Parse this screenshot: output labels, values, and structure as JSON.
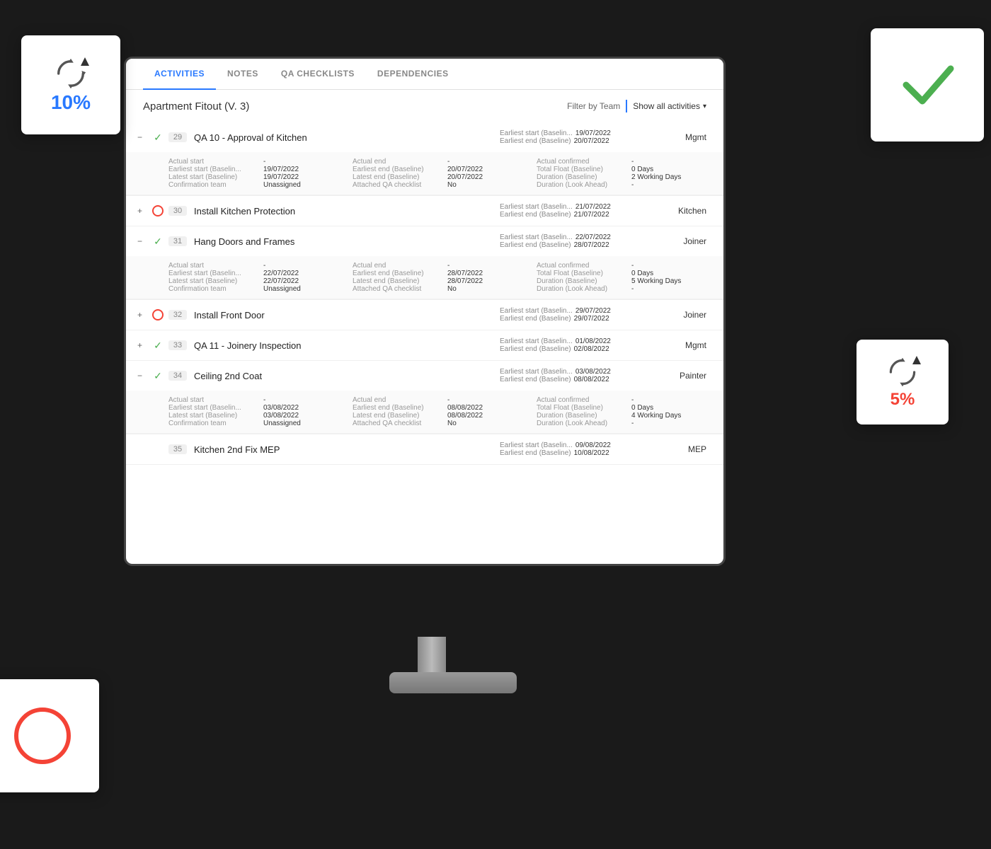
{
  "tabs": [
    {
      "id": "activities",
      "label": "ACTIVITIES",
      "active": true
    },
    {
      "id": "notes",
      "label": "NOTES",
      "active": false
    },
    {
      "id": "qa-checklists",
      "label": "QA CHECKLISTS",
      "active": false
    },
    {
      "id": "dependencies",
      "label": "DEPENDENCIES",
      "active": false
    }
  ],
  "header": {
    "project_title": "Apartment Fitout (V. 3)",
    "filter_label": "Filter by Team",
    "filter_value": "Show all activities"
  },
  "activities": [
    {
      "id": "qa10",
      "num": "29",
      "name": "QA 10 - Approval of Kitchen",
      "expanded": true,
      "status": "check",
      "expand_symbol": "−",
      "earliest_start_label": "Earliest start (Baselin...",
      "earliest_start": "19/07/2022",
      "earliest_end_label": "Earliest end (Baseline)",
      "earliest_end": "20/07/2022",
      "team": "Mgmt",
      "details": {
        "col1": [
          {
            "label": "Actual start",
            "value": "-"
          },
          {
            "label": "Earliest start (Baselin...",
            "value": "19/07/2022"
          },
          {
            "label": "Latest start (Baseline)",
            "value": "19/07/2022"
          },
          {
            "label": "Confirmation team",
            "value": "Unassigned"
          }
        ],
        "col2": [
          {
            "label": "Actual end",
            "value": "-"
          },
          {
            "label": "Earliest end (Baseline)",
            "value": "20/07/2022"
          },
          {
            "label": "Latest end (Baseline)",
            "value": "20/07/2022"
          },
          {
            "label": "Attached QA checklist",
            "value": "No"
          }
        ],
        "col3": [
          {
            "label": "Actual confirmed",
            "value": "-"
          },
          {
            "label": "Total Float (Baseline)",
            "value": "0 Days"
          },
          {
            "label": "Duration (Baseline)",
            "value": "2 Working Days"
          },
          {
            "label": "Duration (Look Ahead)",
            "value": "-"
          }
        ]
      }
    },
    {
      "id": "install30",
      "num": "30",
      "name": "Install Kitchen Protection",
      "expanded": false,
      "status": "circle",
      "expand_symbol": "+",
      "earliest_start_label": "Earliest start (Baselin...",
      "earliest_start": "21/07/2022",
      "earliest_end_label": "Earliest end (Baseline)",
      "earliest_end": "21/07/2022",
      "team": "Kitchen"
    },
    {
      "id": "hang31",
      "num": "31",
      "name": "Hang Doors and Frames",
      "expanded": true,
      "status": "check",
      "expand_symbol": "−",
      "earliest_start_label": "Earliest start (Baselin...",
      "earliest_start": "22/07/2022",
      "earliest_end_label": "Earliest end (Baseline)",
      "earliest_end": "28/07/2022",
      "team": "Joiner",
      "details": {
        "col1": [
          {
            "label": "Actual start",
            "value": "-"
          },
          {
            "label": "Earliest start (Baselin...",
            "value": "22/07/2022"
          },
          {
            "label": "Latest start (Baseline)",
            "value": "22/07/2022"
          },
          {
            "label": "Confirmation team",
            "value": "Unassigned"
          }
        ],
        "col2": [
          {
            "label": "Actual end",
            "value": "-"
          },
          {
            "label": "Earliest end (Baseline)",
            "value": "28/07/2022"
          },
          {
            "label": "Latest end (Baseline)",
            "value": "28/07/2022"
          },
          {
            "label": "Attached QA checklist",
            "value": "No"
          }
        ],
        "col3": [
          {
            "label": "Actual confirmed",
            "value": "-"
          },
          {
            "label": "Total Float (Baseline)",
            "value": "0 Days"
          },
          {
            "label": "Duration (Baseline)",
            "value": "5 Working Days"
          },
          {
            "label": "Duration (Look Ahead)",
            "value": "-"
          }
        ]
      }
    },
    {
      "id": "front32",
      "num": "32",
      "name": "Install Front Door",
      "expanded": false,
      "status": "circle",
      "expand_symbol": "+",
      "earliest_start_label": "Earliest start (Baselin...",
      "earliest_start": "29/07/2022",
      "earliest_end_label": "Earliest end (Baseline)",
      "earliest_end": "29/07/2022",
      "team": "Joiner"
    },
    {
      "id": "qa11-33",
      "num": "33",
      "name": "QA 11 - Joinery Inspection",
      "expanded": false,
      "status": "check",
      "expand_symbol": "+",
      "earliest_start_label": "Earliest start (Baselin...",
      "earliest_start": "01/08/2022",
      "earliest_end_label": "Earliest end (Baseline)",
      "earliest_end": "02/08/2022",
      "team": "Mgmt"
    },
    {
      "id": "ceiling34",
      "num": "34",
      "name": "Ceiling 2nd Coat",
      "expanded": true,
      "status": "check",
      "expand_symbol": "−",
      "earliest_start_label": "Earliest start (Baselin...",
      "earliest_start": "03/08/2022",
      "earliest_end_label": "Earliest end (Baseline)",
      "earliest_end": "08/08/2022",
      "team": "Painter",
      "details": {
        "col1": [
          {
            "label": "Actual start",
            "value": "-"
          },
          {
            "label": "Earliest start (Baselin...",
            "value": "03/08/2022"
          },
          {
            "label": "Latest start (Baseline)",
            "value": "03/08/2022"
          },
          {
            "label": "Confirmation team",
            "value": "Unassigned"
          }
        ],
        "col2": [
          {
            "label": "Actual end",
            "value": "-"
          },
          {
            "label": "Earliest end (Baseline)",
            "value": "08/08/2022"
          },
          {
            "label": "Latest end (Baseline)",
            "value": "08/08/2022"
          },
          {
            "label": "Attached QA checklist",
            "value": "No"
          }
        ],
        "col3": [
          {
            "label": "Actual confirmed",
            "value": "-"
          },
          {
            "label": "Total Float (Baseline)",
            "value": "0 Days"
          },
          {
            "label": "Duration (Baseline)",
            "value": "4 Working Days"
          },
          {
            "label": "Duration (Look Ahead)",
            "value": "-"
          }
        ]
      }
    },
    {
      "id": "kitchen35",
      "num": "35",
      "name": "Kitchen 2nd Fix MEP",
      "expanded": false,
      "status": "none",
      "expand_symbol": "",
      "earliest_start_label": "Earliest start (Baselin...",
      "earliest_start": "09/08/2022",
      "earliest_end_label": "Earliest end (Baseline)",
      "earliest_end": "10/08/2022",
      "team": "MEP"
    }
  ],
  "float_cards": {
    "sync10": {
      "percent": "10%",
      "color": "#2979ff"
    },
    "checkmark": {
      "symbol": "✓"
    },
    "sync5": {
      "percent": "5%",
      "color": "#f44336"
    },
    "circle": {}
  }
}
